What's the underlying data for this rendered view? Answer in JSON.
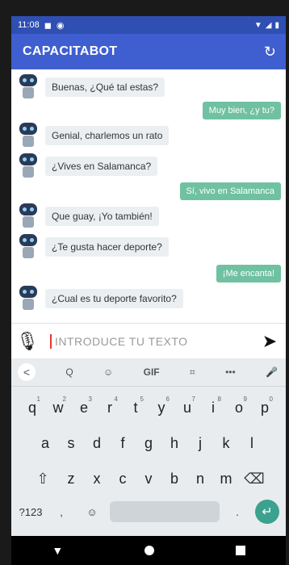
{
  "status": {
    "time": "11:08",
    "left_icons": [
      "lock-icon",
      "sync-icon"
    ],
    "right_icons": [
      "wifi-icon",
      "signal-icon",
      "battery-icon"
    ]
  },
  "appbar": {
    "title": "CAPACITABOT",
    "refresh_icon": "refresh-icon"
  },
  "messages": [
    {
      "from": "bot",
      "text": "Buenas, ¿Qué tal estas?"
    },
    {
      "from": "user",
      "text": "Muy bien, ¿y tu?"
    },
    {
      "from": "bot",
      "text": "Genial, charlemos un rato"
    },
    {
      "from": "bot",
      "text": "¿Vives en Salamanca?"
    },
    {
      "from": "user",
      "text": "Sí, vivo en Salamanca"
    },
    {
      "from": "bot",
      "text": "Que guay, ¡Yo también!"
    },
    {
      "from": "bot",
      "text": "¿Te gusta hacer deporte?"
    },
    {
      "from": "user",
      "text": "¡Me encanta!"
    },
    {
      "from": "bot",
      "text": "¿Cual es tu deporte favorito?"
    }
  ],
  "input": {
    "placeholder": "INTRODUCE TU TEXTO",
    "mic_icon": "mic-icon",
    "send_icon": "send-icon"
  },
  "keyboard": {
    "toolbar": [
      "<",
      "Q",
      "☺",
      "GIF",
      "⌗",
      "•••",
      "🎤"
    ],
    "row1": [
      {
        "k": "q",
        "n": "1"
      },
      {
        "k": "w",
        "n": "2"
      },
      {
        "k": "e",
        "n": "3"
      },
      {
        "k": "r",
        "n": "4"
      },
      {
        "k": "t",
        "n": "5"
      },
      {
        "k": "y",
        "n": "6"
      },
      {
        "k": "u",
        "n": "7"
      },
      {
        "k": "i",
        "n": "8"
      },
      {
        "k": "o",
        "n": "9"
      },
      {
        "k": "p",
        "n": "0"
      }
    ],
    "row2": [
      "a",
      "s",
      "d",
      "f",
      "g",
      "h",
      "j",
      "k",
      "l"
    ],
    "row3": [
      "⇧",
      "z",
      "x",
      "c",
      "v",
      "b",
      "n",
      "m",
      "⌫"
    ],
    "bottom": {
      "sym": "?123",
      "comma": ",",
      "emoji": "☺",
      "period": ".",
      "enter": "↵"
    }
  },
  "colors": {
    "appbar": "#3f5fd0",
    "user_bubble": "#70c1a2",
    "bot_bubble": "#eceff1",
    "enter": "#3ba28f"
  }
}
